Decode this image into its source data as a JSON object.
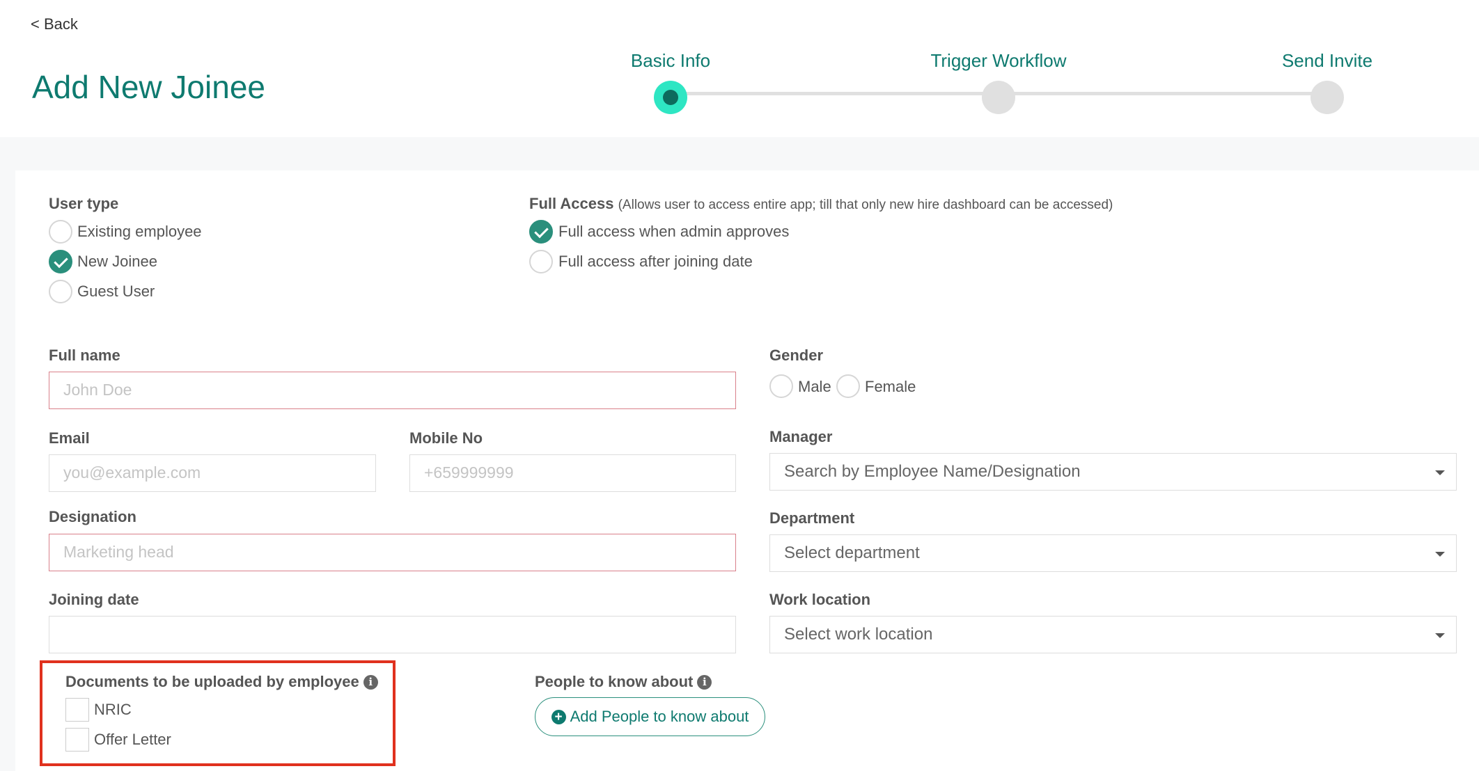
{
  "header": {
    "back_label": "<  Back",
    "title": "Add New Joinee"
  },
  "steps": [
    {
      "label": "Basic Info",
      "active": true
    },
    {
      "label": "Trigger Workflow",
      "active": false
    },
    {
      "label": "Send Invite",
      "active": false
    }
  ],
  "user_type": {
    "label": "User type",
    "options": [
      "Existing employee",
      "New Joinee",
      "Guest User"
    ],
    "selected": "New Joinee"
  },
  "full_access": {
    "label": "Full Access",
    "note": "(Allows user to access entire app; till that only new hire dashboard can be accessed)",
    "options": [
      "Full access when admin approves",
      "Full access after joining date"
    ],
    "selected": "Full access when admin approves"
  },
  "form": {
    "full_name": {
      "label": "Full name",
      "placeholder": "John Doe"
    },
    "gender": {
      "label": "Gender",
      "options": [
        "Male",
        "Female"
      ]
    },
    "email": {
      "label": "Email",
      "placeholder": "you@example.com"
    },
    "mobile": {
      "label": "Mobile No",
      "placeholder": "+659999999"
    },
    "manager": {
      "label": "Manager",
      "placeholder": "Search by Employee Name/Designation"
    },
    "designation": {
      "label": "Designation",
      "placeholder": "Marketing head"
    },
    "department": {
      "label": "Department",
      "placeholder": "Select department"
    },
    "joining_date": {
      "label": "Joining date",
      "value": ""
    },
    "work_location": {
      "label": "Work location",
      "placeholder": "Select work location"
    }
  },
  "documents": {
    "label": "Documents to be uploaded by employee",
    "items": [
      "NRIC",
      "Offer Letter"
    ]
  },
  "people": {
    "label": "People to know about",
    "button_label": "Add People to know about"
  },
  "colors": {
    "accent": "#0e7a6f",
    "active_step": "#2ee6c3",
    "checked": "#2a8f7c",
    "error_border": "#d9808a",
    "highlight": "#e0311e"
  }
}
